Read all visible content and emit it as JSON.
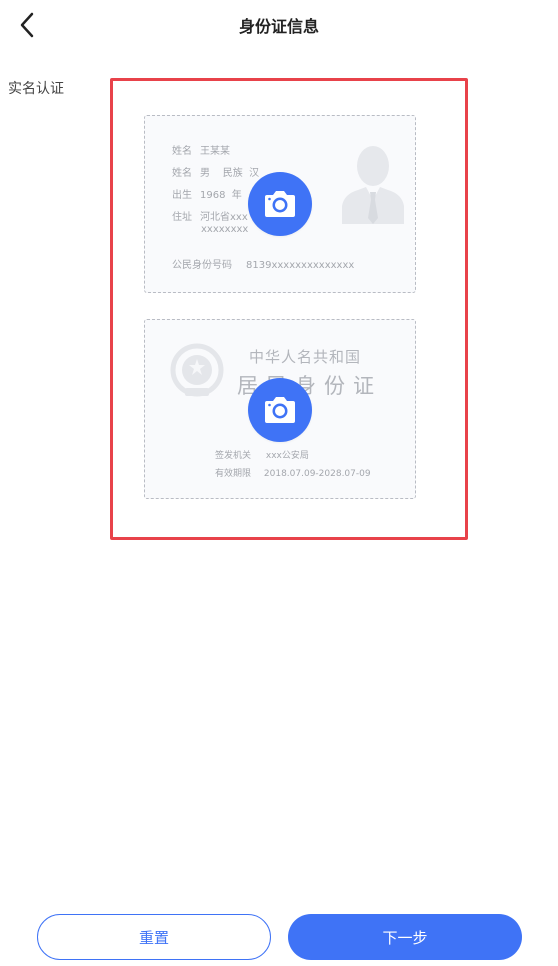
{
  "header": {
    "title": "身份证信息",
    "back_icon": "chevron-left-icon"
  },
  "section": {
    "label": "实名认证"
  },
  "front_card": {
    "rows": [
      {
        "key": "姓名",
        "value": "王某某"
      },
      {
        "key": "姓名",
        "value": "男    民族  汉"
      },
      {
        "key": "出生",
        "value": "1968  年"
      },
      {
        "key": "住址",
        "value": "河北省xxx"
      }
    ],
    "address_line2": "xxxxxxxx",
    "id_label": "公民身份号码",
    "id_value": "8139xxxxxxxxxxxxxx",
    "camera_icon": "camera-icon",
    "avatar_icon": "person-silhouette-icon"
  },
  "back_card": {
    "country": "中华人名共和国",
    "card_name": "居民身份证",
    "issuer_label": "签发机关",
    "issuer_value": "xxx公安局",
    "valid_label": "有效期限",
    "valid_value": "2018.07.09-2028.07-09",
    "camera_icon": "camera-icon",
    "emblem_icon": "national-emblem-icon"
  },
  "buttons": {
    "reset": "重置",
    "next": "下一步"
  },
  "colors": {
    "primary": "#3f73f6",
    "highlight_border": "#e8424a"
  }
}
